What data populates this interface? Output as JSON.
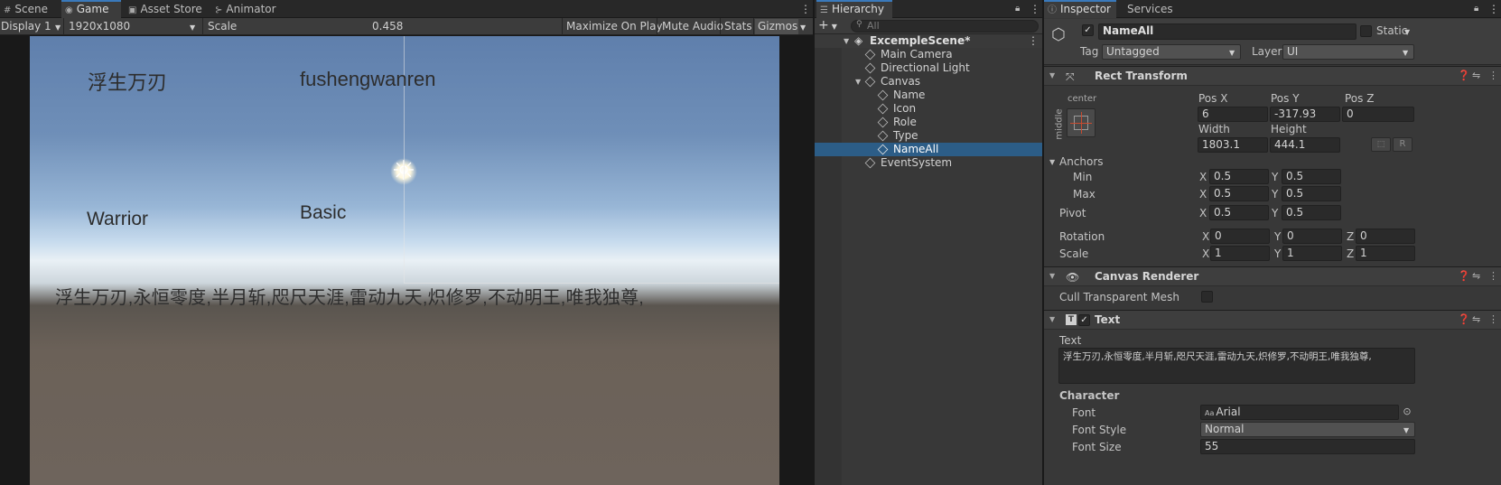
{
  "scene_panel": {
    "tabs": [
      {
        "label": "Scene",
        "icon": "grid-icon"
      },
      {
        "label": "Game",
        "icon": "gamepad-icon"
      },
      {
        "label": "Asset Store",
        "icon": "bag-icon"
      },
      {
        "label": "Animator",
        "icon": "graph-icon"
      }
    ],
    "toolbar": {
      "display": "Display 1",
      "resolution": "1920x1080",
      "scale_label": "Scale",
      "scale_value": "0.458",
      "maximize": "Maximize On Play",
      "mute": "Mute Audio",
      "stats": "Stats",
      "gizmos": "Gizmos"
    },
    "game_view": {
      "name_cn": "浮生万刃",
      "name_pinyin": "fushengwanren",
      "role": "Warrior",
      "type": "Basic",
      "name_all": "浮生万刃,永恒零度,半月斩,咫尺天涯,雷动九天,炽修罗,不动明王,唯我独尊,"
    }
  },
  "hierarchy": {
    "tab": "Hierarchy",
    "search_placeholder": "All",
    "scene": "ExcempleScene*",
    "items": [
      "Main Camera",
      "Directional Light",
      "Canvas",
      "Name",
      "Icon",
      "Role",
      "Type",
      "NameAll",
      "EventSystem"
    ]
  },
  "inspector": {
    "tabs": [
      "Inspector",
      "Services"
    ],
    "object_name": "NameAll",
    "static_label": "Static",
    "tag_label": "Tag",
    "tag_value": "Untagged",
    "layer_label": "Layer",
    "layer_value": "UI",
    "rect_transform": {
      "title": "Rect Transform",
      "anchor_h": "center",
      "anchor_v": "middle",
      "pos_x_label": "Pos X",
      "pos_x": "6",
      "pos_y_label": "Pos Y",
      "pos_y": "-317.93",
      "pos_z_label": "Pos Z",
      "pos_z": "0",
      "width_label": "Width",
      "width": "1803.1",
      "height_label": "Height",
      "height": "444.1",
      "r_button": "R",
      "anchors_label": "Anchors",
      "min_label": "Min",
      "min_x": "0.5",
      "min_y": "0.5",
      "max_label": "Max",
      "max_x": "0.5",
      "max_y": "0.5",
      "pivot_label": "Pivot",
      "pivot_x": "0.5",
      "pivot_y": "0.5",
      "rotation_label": "Rotation",
      "rot_x": "0",
      "rot_y": "0",
      "rot_z": "0",
      "scale_label": "Scale",
      "scale_x": "1",
      "scale_y": "1",
      "scale_z": "1",
      "x": "X",
      "y": "Y",
      "z": "Z"
    },
    "canvas_renderer": {
      "title": "Canvas Renderer",
      "cull_label": "Cull Transparent Mesh"
    },
    "text_component": {
      "title": "Text",
      "text_label": "Text",
      "text_value": "浮生万刃,永恒零度,半月斩,咫尺天涯,雷动九天,炽修罗,不动明王,唯我独尊,",
      "character_label": "Character",
      "font_label": "Font",
      "font_value": "Arial",
      "font_style_label": "Font Style",
      "font_style_value": "Normal",
      "font_size_label": "Font Size",
      "font_size_value": "55"
    }
  },
  "colors": {
    "accent": "#3a79bb",
    "selection": "#2c5d87",
    "panel_bg": "#383838"
  }
}
